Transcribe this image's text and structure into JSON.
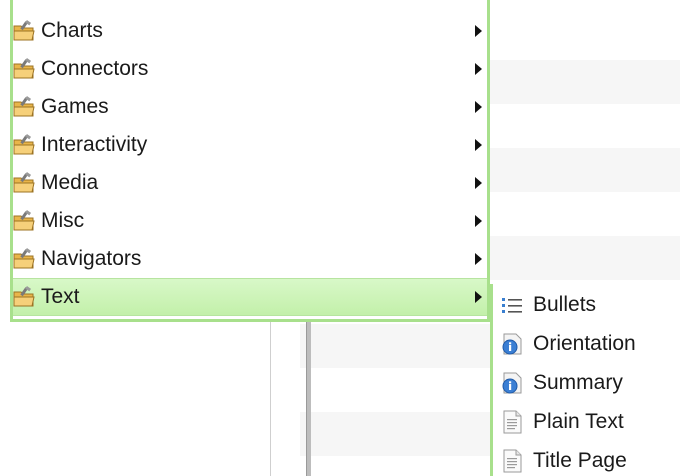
{
  "menu": {
    "items": [
      {
        "label": "Charts",
        "icon": "folder-icon",
        "has_submenu": true,
        "active": false
      },
      {
        "label": "Connectors",
        "icon": "folder-icon",
        "has_submenu": true,
        "active": false
      },
      {
        "label": "Games",
        "icon": "folder-icon",
        "has_submenu": true,
        "active": false
      },
      {
        "label": "Interactivity",
        "icon": "folder-icon",
        "has_submenu": true,
        "active": false
      },
      {
        "label": "Media",
        "icon": "folder-icon",
        "has_submenu": true,
        "active": false
      },
      {
        "label": "Misc",
        "icon": "folder-icon",
        "has_submenu": true,
        "active": false
      },
      {
        "label": "Navigators",
        "icon": "folder-icon",
        "has_submenu": true,
        "active": false
      },
      {
        "label": "Text",
        "icon": "folder-icon",
        "has_submenu": true,
        "active": true
      }
    ]
  },
  "submenu": {
    "items": [
      {
        "label": "Bullets",
        "icon": "bullets-icon"
      },
      {
        "label": "Orientation",
        "icon": "info-icon"
      },
      {
        "label": "Summary",
        "icon": "info-icon"
      },
      {
        "label": "Plain Text",
        "icon": "document-icon"
      },
      {
        "label": "Title Page",
        "icon": "document-icon"
      }
    ]
  },
  "colors": {
    "menu_border": "#a8e08c",
    "active_highlight": "#c3f0aa",
    "text": "#1a1a1a"
  }
}
